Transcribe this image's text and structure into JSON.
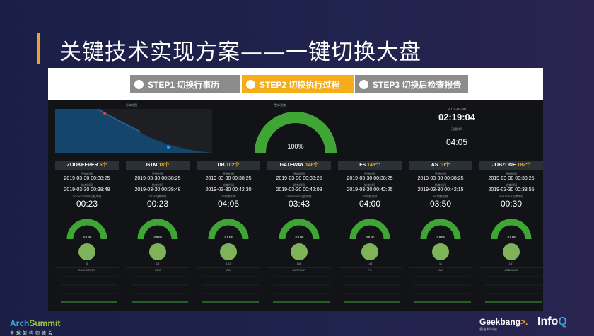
{
  "slide": {
    "title": "关键技术实现方案——一键切换大盘"
  },
  "steps": [
    {
      "label": "STEP1 切换行事历",
      "active": false
    },
    {
      "label": "STEP2 切换执行过程",
      "active": true
    },
    {
      "label": "STEP3 切换后检查报告",
      "active": false
    }
  ],
  "dashboard": {
    "map_title": "总体地图",
    "main_gauge_title": "整体进度",
    "main_gauge_value": "100%",
    "main_gauge_progress": 1.0,
    "clock": {
      "date": "2019-03-30",
      "time": "02:19:04",
      "elapsed_label": "已用时间",
      "elapsed": "04:05"
    },
    "columns": [
      {
        "name": "ZOOKEEPER",
        "count": "5个",
        "sublabel1": "开始时间",
        "start": "2019-03-30 00:38:25",
        "sublabel2": "结束时间",
        "end": "2019-03-30 00:38:48",
        "sublabel3": "ZOOKEEPER切换用时",
        "duration": "00:23",
        "gauge": "100%",
        "pie_count": "5",
        "chart_title": "ZOOKEEPER"
      },
      {
        "name": "GTM",
        "count": "18个",
        "sublabel1": "开始时间",
        "start": "2019-03-30 00:38:25",
        "sublabel2": "结束时间",
        "end": "2019-03-30 00:38:48",
        "sublabel3": "GTM切换用时",
        "duration": "00:23",
        "gauge": "100%",
        "pie_count": "18",
        "chart_title": "GTM"
      },
      {
        "name": "DB",
        "count": "102个",
        "sublabel1": "开始时间",
        "start": "2019-03-30 00:38:25",
        "sublabel2": "结束时间",
        "end": "2019-03-30 00:42:30",
        "sublabel3": "DB切换用时",
        "duration": "04:05",
        "gauge": "100%",
        "pie_count": "102",
        "chart_title": "DB"
      },
      {
        "name": "GATEWAY",
        "count": "146个",
        "sublabel1": "开始时间",
        "start": "2019-03-30 00:38:25",
        "sublabel2": "结束时间",
        "end": "2019-03-30 00:42:08",
        "sublabel3": "GATEWAY切换用时",
        "duration": "03:43",
        "gauge": "100%",
        "pie_count": "146",
        "chart_title": "GATEWAY"
      },
      {
        "name": "FS",
        "count": "145个",
        "sublabel1": "开始时间",
        "start": "2019-03-30 00:38:25",
        "sublabel2": "结束时间",
        "end": "2019-03-30 00:42:25",
        "sublabel3": "FS切换用时",
        "duration": "04:00",
        "gauge": "100%",
        "pie_count": "145",
        "chart_title": "FS"
      },
      {
        "name": "AS",
        "count": "10个",
        "sublabel1": "开始时间",
        "start": "2019-03-30 00:38:25",
        "sublabel2": "结束时间",
        "end": "2019-03-30 00:42:15",
        "sublabel3": "AS切换用时",
        "duration": "03:50",
        "gauge": "100%",
        "pie_count": "11",
        "chart_title": "AS"
      },
      {
        "name": "JOBZONE",
        "count": "182个",
        "sublabel1": "开始时间",
        "start": "2019-03-30 00:38:25",
        "sublabel2": "结束时间",
        "end": "2019-03-30 00:38:55",
        "sublabel3": "JOBZONE切换用时",
        "duration": "00:30",
        "gauge": "100%",
        "pie_count": "187",
        "chart_title": "JOBZONE"
      }
    ]
  },
  "footer": {
    "archsummit_a": "Arch",
    "archsummit_b": "Summit",
    "archsummit_sub": "全球架构师峰会",
    "geekbang": "Geekbang",
    "geekbang_arrow": ">.",
    "geekbang_sub": "极客邦科技",
    "infoq_a": "Info",
    "infoq_b": "Q"
  },
  "colors": {
    "accent_orange": "#f5ad1a",
    "gauge_green": "#3fa535",
    "step_gray": "#8c8c8c"
  }
}
